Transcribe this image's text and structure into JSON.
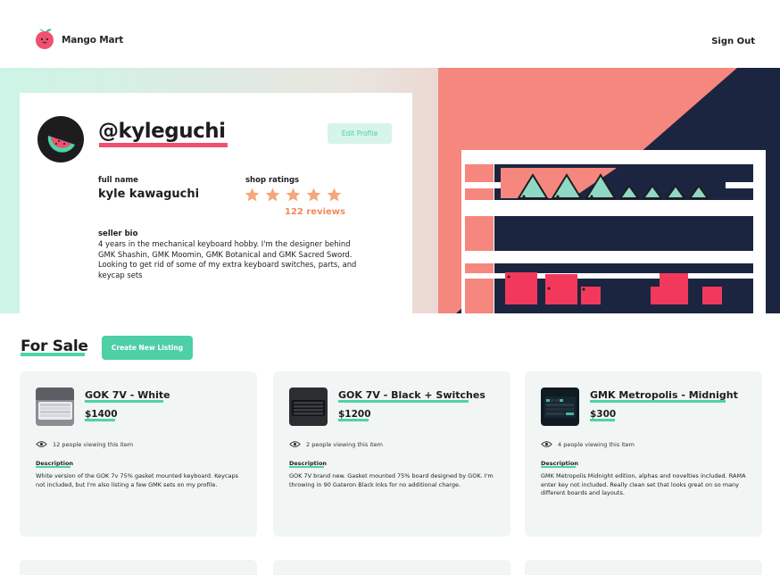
{
  "header": {
    "brand": "Mango Mart",
    "sign_out": "Sign Out"
  },
  "profile": {
    "username": "@kyleguchi",
    "edit_label": "Edit Profile",
    "full_name_label": "full name",
    "full_name": "kyle kawaguchi",
    "ratings_label": "shop ratings",
    "rating": 5,
    "rating_max": 5,
    "reviews": "122 reviews",
    "bio_label": "seller bio",
    "bio": "4 years in the mechanical keyboard hobby. I'm the designer behind GMK Shashin, GMK Moomin, GMK Botanical and GMK Sacred Sword. Looking to get rid of some of my extra keyboard switches, parts, and keycap sets"
  },
  "for_sale": {
    "title": "For Sale",
    "create_label": "Create New Listing",
    "listings": [
      {
        "title": "GOK 7V - White",
        "price": "$1400",
        "viewers": "12 people viewing this item",
        "description_label": "Description",
        "description": "White version of the GOK 7v 75% gasket mounted keyboard. Keycaps not included, but I'm also listing a few GMK sets on my profile."
      },
      {
        "title": "GOK 7V - Black + Switches",
        "price": "$1200",
        "viewers": "2 people viewing this item",
        "description_label": "Description",
        "description": "GOK 7V brand new. Gasket mounted 75% board designed by GOK. I'm throwing in 90 Gateron Black Inks for no additional charge."
      },
      {
        "title": "GMK Metropolis - Midnight",
        "price": "$300",
        "viewers": "4 people viewing this item",
        "description_label": "Description",
        "description": "GMK Metropolis Midnight edition, alphas and novelties included. RAMA enter key not included. Really clean set that looks great on so many different boards and layouts."
      }
    ]
  },
  "colors": {
    "accent_green": "#4ed3a8",
    "accent_pink": "#f0506e",
    "star_orange": "#f4a77a",
    "hero_navy": "#1b2540",
    "hero_coral": "#f5877f"
  },
  "icons": {
    "logo": "mango-icon",
    "avatar": "watermelon-icon",
    "star": "star-icon",
    "viewers": "eye-icon"
  }
}
